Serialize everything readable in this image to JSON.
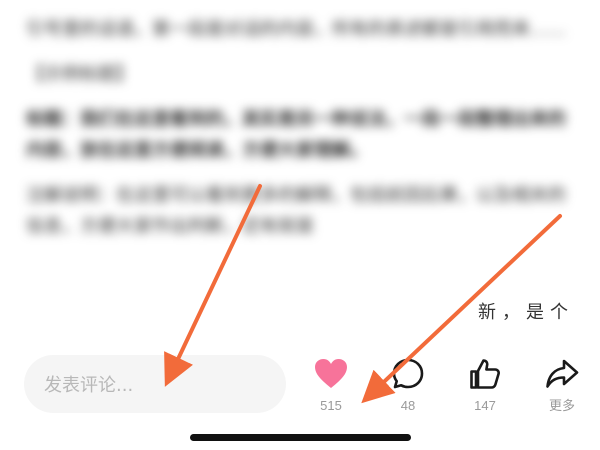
{
  "article": {
    "paragraphs": [
      "引号里的话语，第一段是对话的内容，所有的表述都是引用而来……",
      "【示例标题】",
      "标题：我们在这里看到的，其实是另一种说法，一段一段整理出来的内容，放在这里方便阅读，方便大家理解。",
      "注解说明：在这里可以看到更多的解释，包括前因后果，以及相关的信息，方便大家作出判断，还有就是"
    ],
    "tail_text": "新，是个"
  },
  "comment_bar": {
    "placeholder": "发表评论..."
  },
  "actions": {
    "like_count": "515",
    "comment_count": "48",
    "thumb_count": "147",
    "more_label": "更多"
  },
  "colors": {
    "like_heart": "#f7739a",
    "arrow": "#f26b3a",
    "icon_stroke": "#1a1a1a"
  }
}
